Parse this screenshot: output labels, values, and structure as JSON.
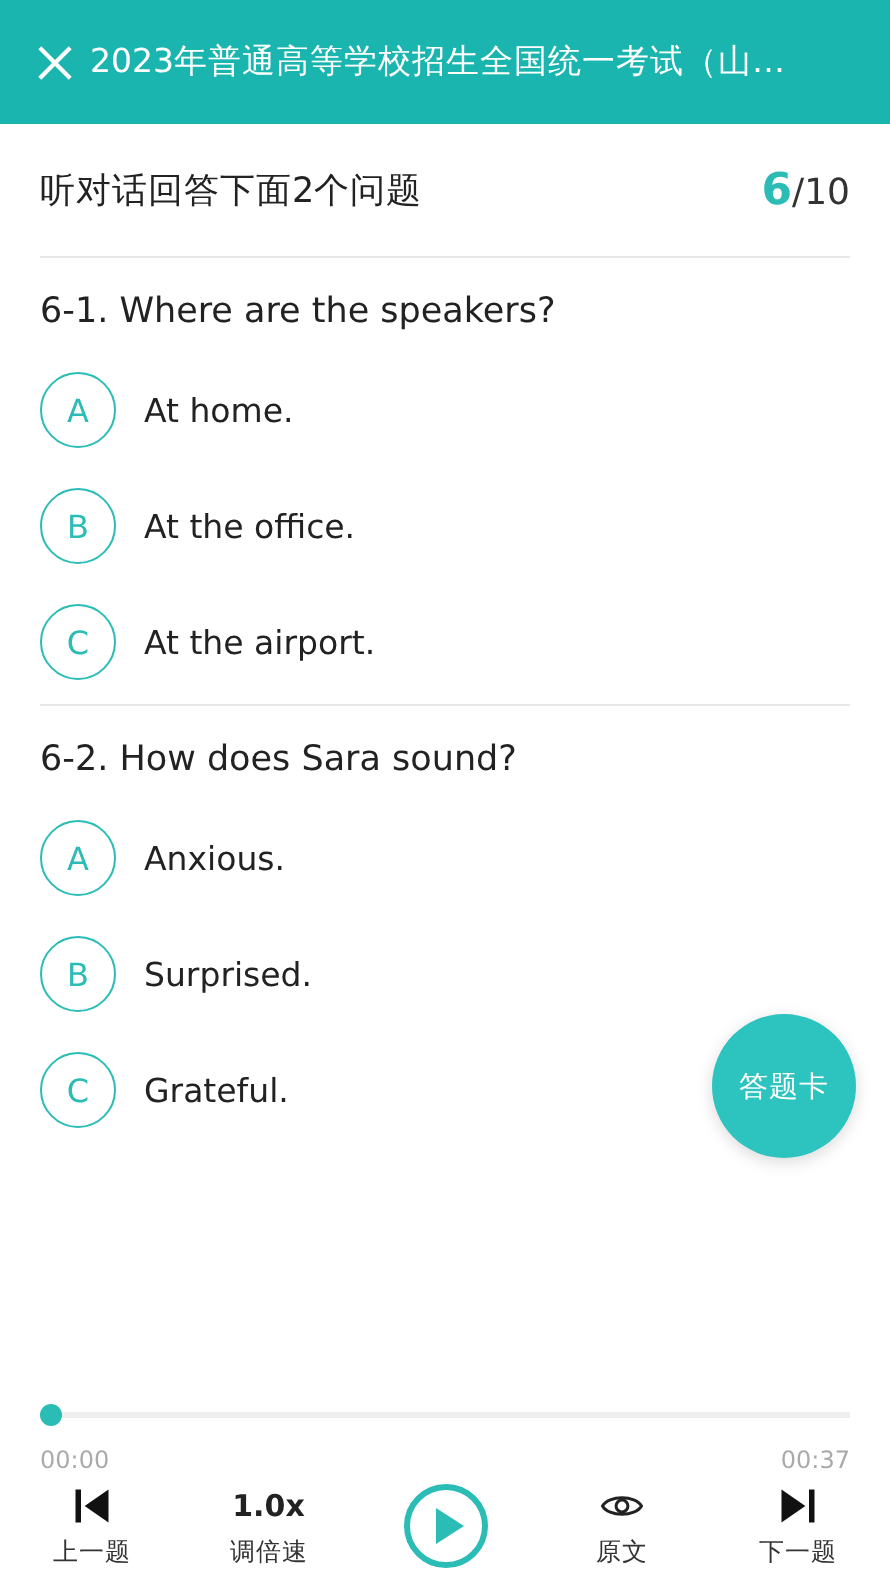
{
  "header": {
    "title": "2023年普通高等学校招生全国统一考试（山…"
  },
  "section": {
    "instruction": "听对话回答下面2个问题",
    "current": "6",
    "total": "/10"
  },
  "questions": [
    {
      "text": "6-1. Where are the speakers?",
      "options": [
        {
          "letter": "A",
          "text": "At home.",
          "selected": false
        },
        {
          "letter": "B",
          "text": "At the office.",
          "selected": false
        },
        {
          "letter": "C",
          "text": "At the airport.",
          "selected": false
        }
      ]
    },
    {
      "text": "6-2. How does Sara sound?",
      "options": [
        {
          "letter": "A",
          "text": "Anxious.",
          "selected": false
        },
        {
          "letter": "B",
          "text": "Surprised.",
          "selected": false
        },
        {
          "letter": "C",
          "text": "Grateful.",
          "selected": false
        }
      ]
    }
  ],
  "answer_card": "答题卡",
  "player": {
    "level": 0,
    "elapsed": "00:00",
    "duration": "00:37",
    "controls": [
      {
        "kind": "prev",
        "label": "上一题"
      },
      {
        "kind": "speed",
        "value": "1.0x",
        "label": "调倍速"
      },
      {
        "kind": "play"
      },
      {
        "kind": "original",
        "label": "原文"
      },
      {
        "kind": "next",
        "label": "下一题"
      }
    ]
  }
}
